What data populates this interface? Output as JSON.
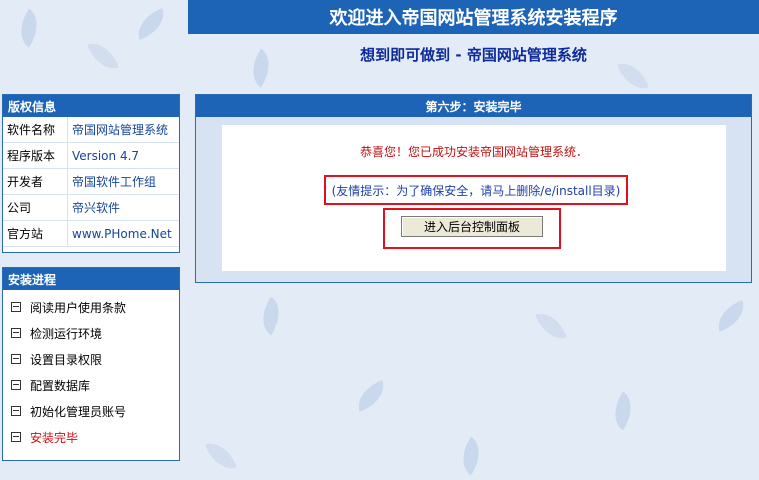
{
  "banner": {
    "title": "欢迎进入帝国网站管理系统安装程序"
  },
  "slogan": "想到即可做到  - 帝国网站管理系统",
  "copyright": {
    "title": "版权信息",
    "rows": [
      {
        "key": "软件名称",
        "value": "帝国网站管理系统"
      },
      {
        "key": "程序版本",
        "value": "Version 4.7"
      },
      {
        "key": "开发者",
        "value": "帝国软件工作组"
      },
      {
        "key": "公司",
        "value": "帝兴软件"
      },
      {
        "key": "官方站",
        "value": "www.PHome.Net"
      }
    ]
  },
  "progress": {
    "title": "安装进程",
    "steps": [
      {
        "label": "阅读用户使用条款"
      },
      {
        "label": "检测运行环境"
      },
      {
        "label": "设置目录权限"
      },
      {
        "label": "配置数据库"
      },
      {
        "label": "初始化管理员账号"
      },
      {
        "label": "安装完毕"
      }
    ],
    "active_color": "#d01010"
  },
  "main": {
    "title": "第六步：安装完毕",
    "congrats": "恭喜您！您已成功安装帝国网站管理系统．",
    "tip": "(友情提示：为了确保安全，请马上删除/e/install目录)",
    "button_label": "进入后台控制面板"
  },
  "colors": {
    "header_blue": "#1d64b6",
    "highlight_red": "#e0101e",
    "page_bg": "#e3ebf6"
  }
}
